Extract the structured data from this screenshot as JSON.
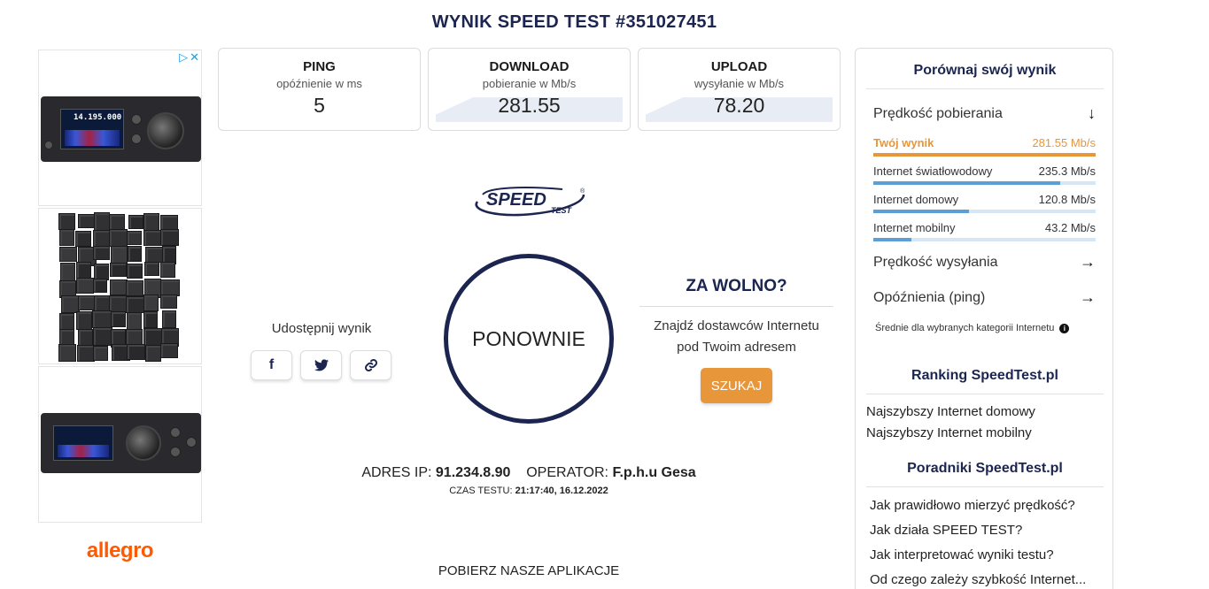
{
  "page": {
    "title": "WYNIK SPEED TEST #351027451"
  },
  "ads": {
    "choices_icon": "ad-choices-icon",
    "brand": "allegro"
  },
  "stats": [
    {
      "title": "PING",
      "sub": "opóźnienie w ms",
      "value": "5"
    },
    {
      "title": "DOWNLOAD",
      "sub": "pobieranie w Mb/s",
      "value": "281.55"
    },
    {
      "title": "UPLOAD",
      "sub": "wysyłanie w Mb/s",
      "value": "78.20"
    }
  ],
  "logo": {
    "word": "SPEED",
    "sub": "TEST",
    "mark": "®"
  },
  "share": {
    "label": "Udostępnij wynik",
    "facebook": "f",
    "twitter": "twitter-icon",
    "link": "link-icon"
  },
  "again_label": "PONOWNIE",
  "slow": {
    "title": "ZA WOLNO?",
    "line1": "Znajdź dostawców Internetu",
    "line2": "pod Twoim adresem",
    "button": "SZUKAJ"
  },
  "ip": {
    "ip_label": "ADRES IP:",
    "ip_value": "91.234.8.90",
    "op_label": "OPERATOR:",
    "op_value": "F.p.h.u Gesa",
    "time_label": "CZAS TESTU:",
    "time_value": "21:17:40, 16.12.2022"
  },
  "apps_label": "POBIERZ NASZE APLIKACJE",
  "compare": {
    "title": "Porównaj swój wynik",
    "download_label": "Prędkość pobierania",
    "rows": [
      {
        "label": "Twój wynik",
        "value": "281.55 Mb/s",
        "fraction": 1.0
      },
      {
        "label": "Internet światłowodowy",
        "value": "235.3 Mb/s",
        "fraction": 0.84
      },
      {
        "label": "Internet domowy",
        "value": "120.8 Mb/s",
        "fraction": 0.43
      },
      {
        "label": "Internet mobilny",
        "value": "43.2 Mb/s",
        "fraction": 0.17
      }
    ],
    "upload_label": "Prędkość wysyłania",
    "ping_label": "Opóźnienia (ping)",
    "note": "Średnie dla wybranych kategorii Internetu",
    "info": "i"
  },
  "ranking": {
    "title": "Ranking SpeedTest.pl",
    "links": [
      "Najszybszy Internet domowy",
      "Najszybszy Internet mobilny"
    ]
  },
  "guides": {
    "title": "Poradniki SpeedTest.pl",
    "links": [
      "Jak prawidłowo mierzyć prędkość?",
      "Jak działa SPEED TEST?",
      "Jak interpretować wyniki testu?",
      "Od czego zależy szybkość Internet..."
    ]
  },
  "radio_display": "14.195.000",
  "colors": {
    "navy": "#1b2550",
    "orange": "#e8963a",
    "blue_bar": "#5a9fd8"
  }
}
